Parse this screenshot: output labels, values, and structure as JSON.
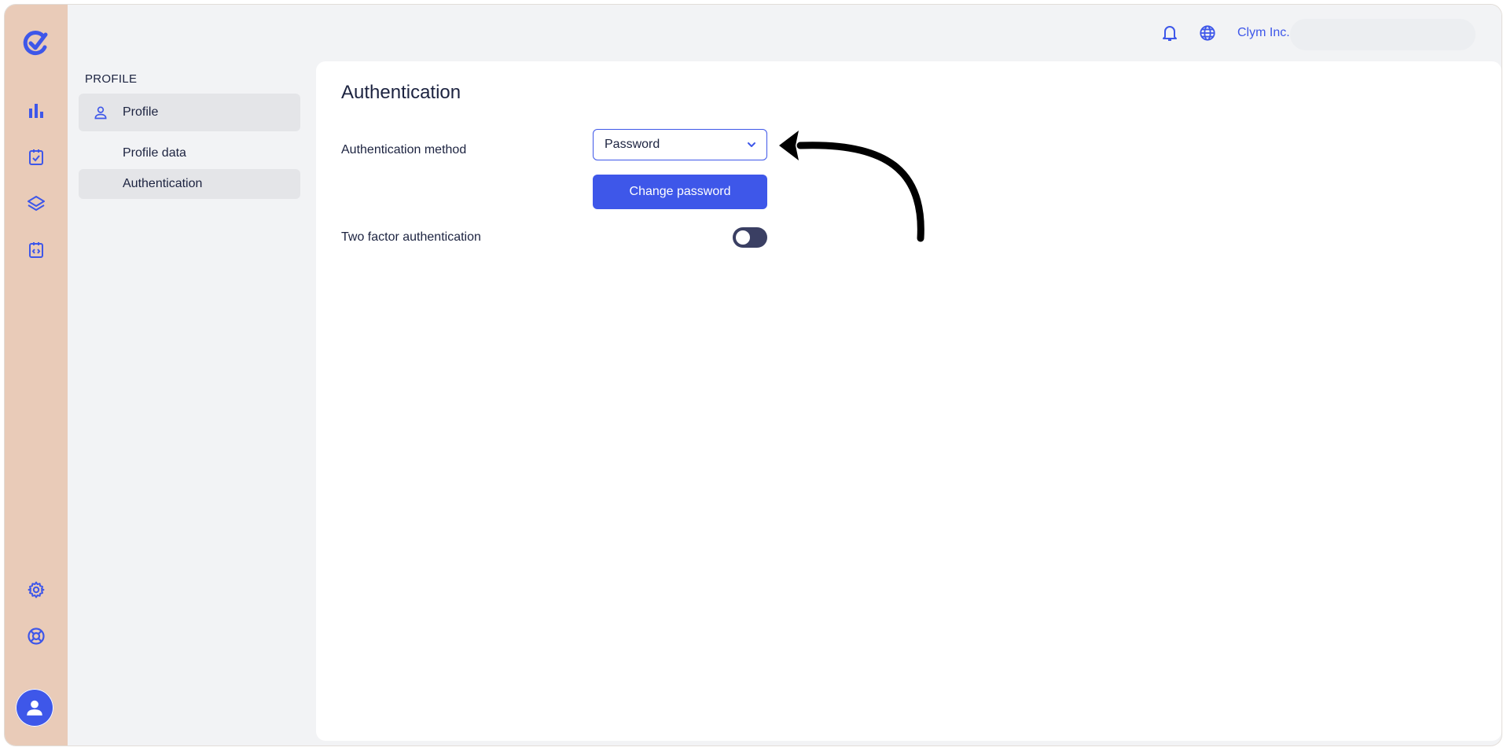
{
  "app": {
    "org_name": "Clym Inc.",
    "accent_color": "#3e57e9",
    "rail_color": "#e9cbb8"
  },
  "rail": {
    "icons": [
      "logo-icon",
      "analytics-icon",
      "tasks-icon",
      "layers-icon",
      "code-clipboard-icon",
      "settings-icon",
      "support-icon",
      "user-avatar-icon"
    ]
  },
  "topbar": {
    "notification_icon": "bell-icon",
    "language_icon": "globe-icon"
  },
  "sidebar": {
    "section_title": "PROFILE",
    "items": [
      {
        "label": "Profile",
        "icon": "person-icon"
      },
      {
        "label": "Profile data"
      },
      {
        "label": "Authentication"
      }
    ]
  },
  "content": {
    "title": "Authentication",
    "auth_method_label": "Authentication method",
    "auth_method_value": "Password",
    "change_password_label": "Change password",
    "two_factor_label": "Two factor authentication",
    "two_factor_enabled": false
  }
}
